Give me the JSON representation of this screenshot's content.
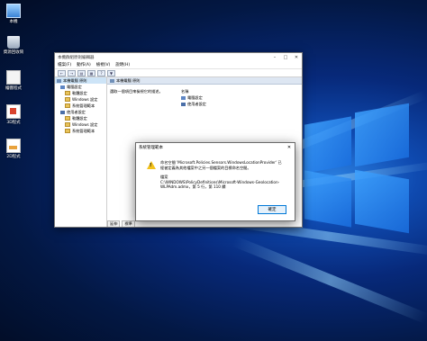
{
  "desktop": {
    "icons": [
      {
        "label": "本機",
        "icon": "computer-icon"
      },
      {
        "label": "資源回收筒",
        "icon": "recycle-bin-icon"
      },
      {
        "label": "繪圖程式",
        "icon": "app-icon"
      },
      {
        "label": "3D程式",
        "icon": "3d-icon"
      },
      {
        "label": "2D程式",
        "icon": "2d-icon"
      }
    ]
  },
  "gpedit": {
    "title": "本機群組原則編輯器",
    "menu": [
      "檔案(F)",
      "動作(A)",
      "檢視(V)",
      "說明(H)"
    ],
    "tree": [
      {
        "label": "本機電腦 原則",
        "level": 0
      },
      {
        "label": "電腦設定",
        "level": 1
      },
      {
        "label": "軟體設定",
        "level": 2
      },
      {
        "label": "Windows 設定",
        "level": 2
      },
      {
        "label": "系統管理範本",
        "level": 2
      },
      {
        "label": "使用者設定",
        "level": 1
      },
      {
        "label": "軟體設定",
        "level": 2
      },
      {
        "label": "Windows 設定",
        "level": 2
      },
      {
        "label": "系統管理範本",
        "level": 2
      }
    ],
    "right_header": "本機電腦 原則",
    "description": "選取一個項目來檢視它的描述。",
    "column_name": "名稱",
    "items": [
      "電腦設定",
      "使用者設定"
    ],
    "tabs": [
      "延伸",
      "標準"
    ]
  },
  "dialog": {
    "title": "系統管理範本",
    "line1": "命名空間 'Microsoft.Policies.Sensors.WindowsLocationProvider' 已",
    "line2": "經被定義為其他檔案中之另一個檔案的目標命名空間。",
    "line3": "檔案",
    "line4": "C:\\WINDOWS\\PolicyDefinitions\\Microsoft-Windows-Geolocation-",
    "line5": "WLPAdm.admx，第 5 行，第 110 欄",
    "ok_label": "確定"
  },
  "colors": {
    "warning": "#f3c21b",
    "selection": "#cde4f7",
    "accent": "#0078d7"
  }
}
